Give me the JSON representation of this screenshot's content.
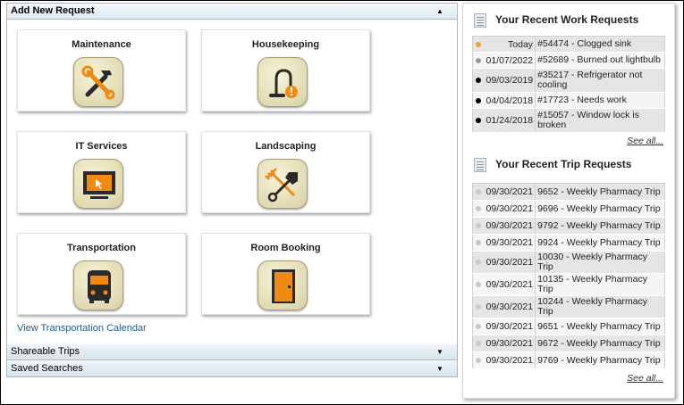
{
  "accordion": {
    "add_request": {
      "title": "Add New Request",
      "toggle": "▲"
    },
    "shareable": {
      "title": "Shareable Trips",
      "toggle": "▼"
    },
    "saved": {
      "title": "Saved Searches",
      "toggle": "▼"
    }
  },
  "tiles": [
    {
      "label": "Maintenance",
      "icon": "tools-icon"
    },
    {
      "label": "Housekeeping",
      "icon": "vacuum-icon"
    },
    {
      "label": "IT Services",
      "icon": "monitor-icon"
    },
    {
      "label": "Landscaping",
      "icon": "rake-shovel-icon"
    },
    {
      "label": "Transportation",
      "icon": "bus-icon"
    },
    {
      "label": "Room Booking",
      "icon": "door-icon"
    }
  ],
  "transport_calendar_link": "View Transportation Calendar",
  "work_requests": {
    "title": "Your Recent Work Requests",
    "see_all": "See all...",
    "rows": [
      {
        "date": "Today",
        "desc": "#54474 - Clogged sink",
        "status_color": "#f0a030"
      },
      {
        "date": "01/07/2022",
        "desc": "#52689 - Burned out lightbulb",
        "status_color": "#9a9a9a"
      },
      {
        "date": "09/03/2019",
        "desc": "#35217 - Refrigerator not cooling",
        "status_color": "#000000"
      },
      {
        "date": "04/04/2018",
        "desc": "#17723 - Needs work",
        "status_color": "#000000"
      },
      {
        "date": "01/24/2018",
        "desc": "#15057 - Window lock is broken",
        "status_color": "#000000"
      }
    ]
  },
  "trip_requests": {
    "title": "Your Recent Trip Requests",
    "see_all": "See all...",
    "rows": [
      {
        "date": "09/30/2021",
        "desc": "9652 - Weekly Pharmacy Trip",
        "status_color": "#c8c8c8"
      },
      {
        "date": "09/30/2021",
        "desc": "9696 - Weekly Pharmacy Trip",
        "status_color": "#c8c8c8"
      },
      {
        "date": "09/30/2021",
        "desc": "9792 - Weekly Pharmacy Trip",
        "status_color": "#c8c8c8"
      },
      {
        "date": "09/30/2021",
        "desc": "9924 - Weekly Pharmacy Trip",
        "status_color": "#c8c8c8"
      },
      {
        "date": "09/30/2021",
        "desc": "10030 - Weekly Pharmacy Trip",
        "status_color": "#c8c8c8"
      },
      {
        "date": "09/30/2021",
        "desc": "10135 - Weekly Pharmacy Trip",
        "status_color": "#c8c8c8"
      },
      {
        "date": "09/30/2021",
        "desc": "10244 - Weekly Pharmacy Trip",
        "status_color": "#c8c8c8"
      },
      {
        "date": "09/30/2021",
        "desc": "9651 - Weekly Pharmacy Trip",
        "status_color": "#c8c8c8"
      },
      {
        "date": "09/30/2021",
        "desc": "9672 - Weekly Pharmacy Trip",
        "status_color": "#c8c8c8"
      },
      {
        "date": "09/30/2021",
        "desc": "9769 - Weekly Pharmacy Trip",
        "status_color": "#c8c8c8"
      }
    ]
  }
}
